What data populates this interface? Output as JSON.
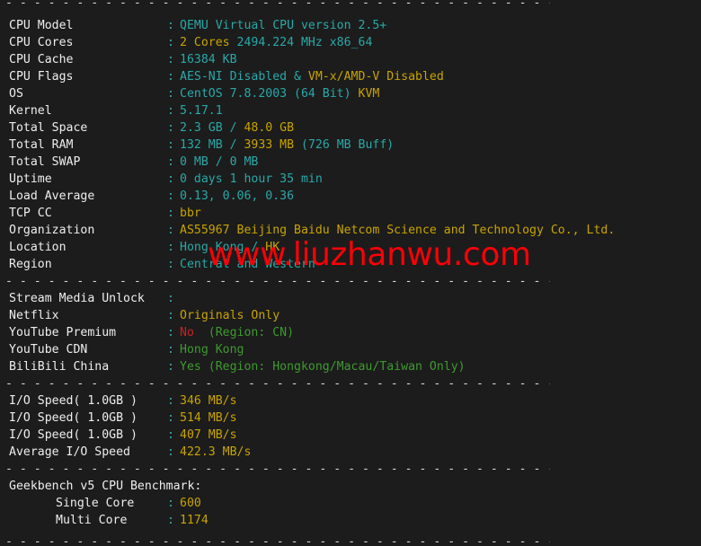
{
  "terminal": {
    "background": "#1c1c1c",
    "label_color": "#eeeeee",
    "cyan": "#2aa8a8",
    "yellow": "#c8a400",
    "green": "#3e9a2f",
    "red": "#cc2222",
    "separator_char": "-",
    "separator": "-------------------------------------------------------------"
  },
  "watermark": {
    "text": "www.liuzhanwu.com",
    "color": "#fb0007"
  },
  "system_info": [
    {
      "label": "CPU Model",
      "colon": ":",
      "parts": [
        {
          "text": "QEMU Virtual CPU version 2.5+",
          "color": "cyan"
        }
      ]
    },
    {
      "label": "CPU Cores",
      "colon": ":",
      "parts": [
        {
          "text": "2 Cores ",
          "color": "yellow"
        },
        {
          "text": "2494.224 MHz x86_64",
          "color": "cyan"
        }
      ]
    },
    {
      "label": "CPU Cache",
      "colon": ":",
      "parts": [
        {
          "text": "16384 KB",
          "color": "cyan"
        }
      ]
    },
    {
      "label": "CPU Flags",
      "colon": ":",
      "parts": [
        {
          "text": "AES-NI Disabled & ",
          "color": "cyan"
        },
        {
          "text": "VM-x/AMD-V Disabled",
          "color": "yellow"
        }
      ]
    },
    {
      "label": "OS",
      "colon": ":",
      "parts": [
        {
          "text": "CentOS 7.8.2003 (64 Bit) ",
          "color": "cyan"
        },
        {
          "text": "KVM",
          "color": "yellow"
        }
      ]
    },
    {
      "label": "Kernel",
      "colon": ":",
      "parts": [
        {
          "text": "5.17.1",
          "color": "cyan"
        }
      ]
    },
    {
      "label": "Total Space",
      "colon": ":",
      "parts": [
        {
          "text": "2.3 GB / ",
          "color": "cyan"
        },
        {
          "text": "48.0 GB",
          "color": "yellow"
        }
      ]
    },
    {
      "label": "Total RAM",
      "colon": ":",
      "parts": [
        {
          "text": "132 MB / ",
          "color": "cyan"
        },
        {
          "text": "3933 MB ",
          "color": "yellow"
        },
        {
          "text": "(726 MB Buff)",
          "color": "cyan"
        }
      ]
    },
    {
      "label": "Total SWAP",
      "colon": ":",
      "parts": [
        {
          "text": "0 MB / 0 MB",
          "color": "cyan"
        }
      ]
    },
    {
      "label": "Uptime",
      "colon": ":",
      "parts": [
        {
          "text": "0 days 1 hour 35 min",
          "color": "cyan"
        }
      ]
    },
    {
      "label": "Load Average",
      "colon": ":",
      "parts": [
        {
          "text": "0.13, 0.06, 0.36",
          "color": "cyan"
        }
      ]
    },
    {
      "label": "TCP CC",
      "colon": ":",
      "parts": [
        {
          "text": "bbr",
          "color": "yellow"
        }
      ]
    },
    {
      "label": "Organization",
      "colon": ":",
      "parts": [
        {
          "text": "AS55967 Beijing Baidu Netcom Science and Technology Co., Ltd.",
          "color": "yellow"
        }
      ]
    },
    {
      "label": "Location",
      "colon": ":",
      "parts": [
        {
          "text": "Hong Kong / ",
          "color": "cyan"
        },
        {
          "text": "HK",
          "color": "yellow"
        }
      ]
    },
    {
      "label": "Region",
      "colon": ":",
      "parts": [
        {
          "text": "Central and Western",
          "color": "cyan"
        }
      ]
    }
  ],
  "stream_media": [
    {
      "label": "Stream Media Unlock",
      "colon": ":",
      "parts": [
        {
          "text": "",
          "color": "green"
        }
      ]
    },
    {
      "label": "Netflix",
      "colon": ":",
      "parts": [
        {
          "text": "Originals Only",
          "color": "yellow"
        }
      ]
    },
    {
      "label": "YouTube Premium",
      "colon": ":",
      "parts": [
        {
          "text": "No",
          "color": "red"
        },
        {
          "text": "  (Region: CN)",
          "color": "green"
        }
      ]
    },
    {
      "label": "YouTube CDN",
      "colon": ":",
      "parts": [
        {
          "text": "Hong Kong",
          "color": "green"
        }
      ]
    },
    {
      "label": "BiliBili China",
      "colon": ":",
      "parts": [
        {
          "text": "Yes (Region: Hongkong/Macau/Taiwan Only)",
          "color": "green"
        }
      ]
    }
  ],
  "io_speed": [
    {
      "label": "I/O Speed( 1.0GB )",
      "colon": ":",
      "parts": [
        {
          "text": "346 MB/s",
          "color": "yellow"
        }
      ]
    },
    {
      "label": "I/O Speed( 1.0GB )",
      "colon": ":",
      "parts": [
        {
          "text": "514 MB/s",
          "color": "yellow"
        }
      ]
    },
    {
      "label": "I/O Speed( 1.0GB )",
      "colon": ":",
      "parts": [
        {
          "text": "407 MB/s",
          "color": "yellow"
        }
      ]
    },
    {
      "label": "Average I/O Speed",
      "colon": ":",
      "parts": [
        {
          "text": "422.3 MB/s",
          "color": "yellow"
        }
      ]
    }
  ],
  "geekbench": {
    "heading": "Geekbench v5 CPU Benchmark:",
    "rows": [
      {
        "label": "Single Core",
        "colon": ":",
        "parts": [
          {
            "text": "600",
            "color": "yellow"
          }
        ]
      },
      {
        "label": "Multi Core",
        "colon": ":",
        "parts": [
          {
            "text": "1174",
            "color": "yellow"
          }
        ]
      }
    ]
  }
}
